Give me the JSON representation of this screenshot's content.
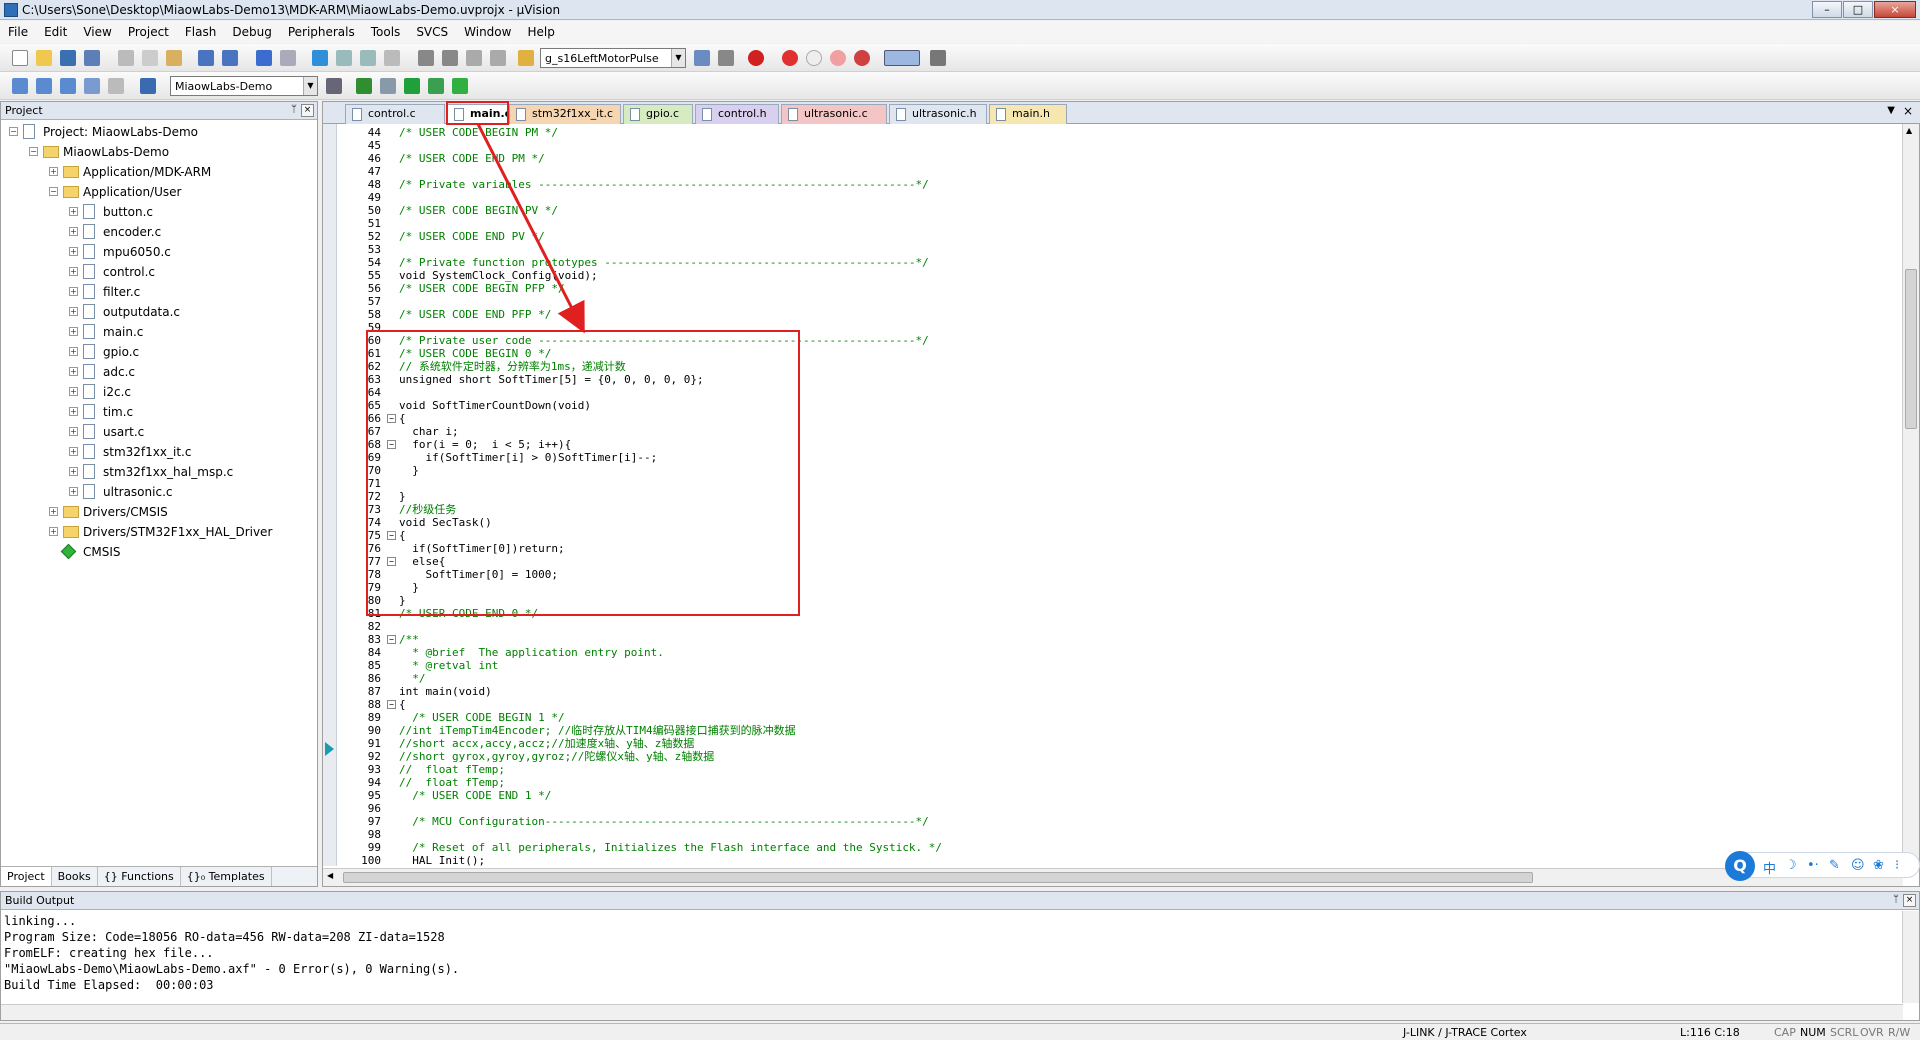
{
  "window": {
    "title": "C:\\Users\\Sone\\Desktop\\MiaowLabs-Demo13\\MDK-ARM\\MiaowLabs-Demo.uvprojx - µVision",
    "min": "–",
    "max": "□",
    "close": "×"
  },
  "menu": [
    "File",
    "Edit",
    "View",
    "Project",
    "Flash",
    "Debug",
    "Peripherals",
    "Tools",
    "SVCS",
    "Window",
    "Help"
  ],
  "toolbar": {
    "symbol_select": "g_s16LeftMotorPulse",
    "target_select": "MiaowLabs-Demo"
  },
  "project_panel": {
    "title": "Project",
    "pin": "ᛘ",
    "close": "×",
    "root": "Project: MiaowLabs-Demo",
    "target": "MiaowLabs-Demo",
    "groups": [
      {
        "name": "Application/MDK-ARM",
        "expanded": false,
        "files": []
      },
      {
        "name": "Application/User",
        "expanded": true,
        "files": [
          "button.c",
          "encoder.c",
          "mpu6050.c",
          "control.c",
          "filter.c",
          "outputdata.c",
          "main.c",
          "gpio.c",
          "adc.c",
          "i2c.c",
          "tim.c",
          "usart.c",
          "stm32f1xx_it.c",
          "stm32f1xx_hal_msp.c",
          "ultrasonic.c"
        ]
      },
      {
        "name": "Drivers/CMSIS",
        "expanded": false,
        "files": []
      },
      {
        "name": "Drivers/STM32F1xx_HAL_Driver",
        "expanded": false,
        "files": []
      }
    ],
    "cmsis": "CMSIS",
    "tabs": [
      "Project",
      "Books",
      "{} Functions",
      "{}₀ Templates"
    ]
  },
  "editor": {
    "tabs": [
      {
        "label": "control.c",
        "color": "#dfe6ef",
        "active": false
      },
      {
        "label": "main.c",
        "color": "#ffffff",
        "active": true
      },
      {
        "label": "stm32f1xx_it.c",
        "color": "#f6d6b0",
        "active": false
      },
      {
        "label": "gpio.c",
        "color": "#d6ecc0",
        "active": false
      },
      {
        "label": "control.h",
        "color": "#d9cfee",
        "active": false
      },
      {
        "label": "ultrasonic.c",
        "color": "#f3c5c5",
        "active": false
      },
      {
        "label": "ultrasonic.h",
        "color": "#dfe6ef",
        "active": false
      },
      {
        "label": "main.h",
        "color": "#f6e7b0",
        "active": false
      }
    ],
    "lines": [
      {
        "n": "44",
        "t": "/* USER CODE BEGIN PM */",
        "c": "cm"
      },
      {
        "n": "45",
        "t": "",
        "c": ""
      },
      {
        "n": "46",
        "t": "/* USER CODE END PM */",
        "c": "cm"
      },
      {
        "n": "47",
        "t": "",
        "c": ""
      },
      {
        "n": "48",
        "t": "/* Private variables ---------------------------------------------------------*/",
        "c": "cm"
      },
      {
        "n": "49",
        "t": "",
        "c": ""
      },
      {
        "n": "50",
        "t": "/* USER CODE BEGIN PV */",
        "c": "cm"
      },
      {
        "n": "51",
        "t": "",
        "c": ""
      },
      {
        "n": "52",
        "t": "/* USER CODE END PV */",
        "c": "cm"
      },
      {
        "n": "53",
        "t": "",
        "c": ""
      },
      {
        "n": "54",
        "t": "/* Private function prototypes -----------------------------------------------*/",
        "c": "cm"
      },
      {
        "n": "55",
        "t": "void SystemClock_Config(void);",
        "c": ""
      },
      {
        "n": "56",
        "t": "/* USER CODE BEGIN PFP */",
        "c": "cm"
      },
      {
        "n": "57",
        "t": "",
        "c": ""
      },
      {
        "n": "58",
        "t": "/* USER CODE END PFP */",
        "c": "cm"
      },
      {
        "n": "59",
        "t": "",
        "c": ""
      },
      {
        "n": "60",
        "t": "/* Private user code ---------------------------------------------------------*/",
        "c": "cm"
      },
      {
        "n": "61",
        "t": "/* USER CODE BEGIN 0 */",
        "c": "cm"
      },
      {
        "n": "62",
        "t": "// 系统软件定时器，分辨率为1ms，递减计数",
        "c": "cm"
      },
      {
        "n": "63",
        "t": "unsigned short SoftTimer[5] = {0, 0, 0, 0, 0};",
        "c": ""
      },
      {
        "n": "64",
        "t": "",
        "c": ""
      },
      {
        "n": "65",
        "t": "void SoftTimerCountDown(void)",
        "c": ""
      },
      {
        "n": "66",
        "t": "{",
        "c": "",
        "f": "−"
      },
      {
        "n": "67",
        "t": "  char i;",
        "c": ""
      },
      {
        "n": "68",
        "t": "  for(i = 0;  i < 5; i++){",
        "c": "",
        "f": "−"
      },
      {
        "n": "69",
        "t": "    if(SoftTimer[i] > 0)SoftTimer[i]--;",
        "c": ""
      },
      {
        "n": "70",
        "t": "  }",
        "c": ""
      },
      {
        "n": "71",
        "t": "",
        "c": ""
      },
      {
        "n": "72",
        "t": "}",
        "c": ""
      },
      {
        "n": "73",
        "t": "//秒级任务",
        "c": "cm"
      },
      {
        "n": "74",
        "t": "void SecTask()",
        "c": ""
      },
      {
        "n": "75",
        "t": "{",
        "c": "",
        "f": "−"
      },
      {
        "n": "76",
        "t": "  if(SoftTimer[0])return;",
        "c": ""
      },
      {
        "n": "77",
        "t": "  else{",
        "c": "",
        "f": "−"
      },
      {
        "n": "78",
        "t": "    SoftTimer[0] = 1000;",
        "c": ""
      },
      {
        "n": "79",
        "t": "  }",
        "c": ""
      },
      {
        "n": "80",
        "t": "}",
        "c": ""
      },
      {
        "n": "81",
        "t": "/* USER CODE END 0 */",
        "c": "cm"
      },
      {
        "n": "82",
        "t": "",
        "c": ""
      },
      {
        "n": "83",
        "t": "/**",
        "c": "cm",
        "f": "−"
      },
      {
        "n": "84",
        "t": "  * @brief  The application entry point.",
        "c": "cm"
      },
      {
        "n": "85",
        "t": "  * @retval int",
        "c": "cm"
      },
      {
        "n": "86",
        "t": "  */",
        "c": "cm"
      },
      {
        "n": "87",
        "t": "int main(void)",
        "c": ""
      },
      {
        "n": "88",
        "t": "{",
        "c": "",
        "f": "−"
      },
      {
        "n": "89",
        "t": "  /* USER CODE BEGIN 1 */",
        "c": "cm"
      },
      {
        "n": "90",
        "t": "//int iTempTim4Encoder; //临时存放从TIM4编码器接口捕获到的脉冲数据",
        "c": "cm"
      },
      {
        "n": "91",
        "t": "//short accx,accy,accz;//加速度x轴、y轴、z轴数据",
        "c": "cm"
      },
      {
        "n": "92",
        "t": "//short gyrox,gyroy,gyroz;//陀螺仪x轴、y轴、z轴数据",
        "c": "cm"
      },
      {
        "n": "93",
        "t": "//  float fTemp;",
        "c": "cm"
      },
      {
        "n": "94",
        "t": "//  float fTemp;",
        "c": "cm"
      },
      {
        "n": "95",
        "t": "  /* USER CODE END 1 */",
        "c": "cm"
      },
      {
        "n": "96",
        "t": "",
        "c": ""
      },
      {
        "n": "97",
        "t": "  /* MCU Configuration--------------------------------------------------------*/",
        "c": "cm"
      },
      {
        "n": "98",
        "t": "",
        "c": ""
      },
      {
        "n": "99",
        "t": "  /* Reset of all peripherals, Initializes the Flash interface and the Systick. */",
        "c": "cm"
      },
      {
        "n": "100",
        "t": "  HAL_Init();",
        "c": ""
      }
    ]
  },
  "build_output": {
    "title": "Build Output",
    "lines": [
      "linking...",
      "Program Size: Code=18056 RO-data=456 RW-data=208 ZI-data=1528",
      "FromELF: creating hex file...",
      "\"MiaowLabs-Demo\\MiaowLabs-Demo.axf\" - 0 Error(s), 0 Warning(s).",
      "Build Time Elapsed:  00:00:03"
    ]
  },
  "status": {
    "debugger": "J-LINK / J-TRACE Cortex",
    "position": "L:116 C:18",
    "cap": "CAP",
    "num": "NUM",
    "scrl": "SCRL",
    "ovr": "OVR",
    "rw": "R/W"
  },
  "ime": {
    "logo": "Q",
    "glyphs": [
      "中",
      "☽",
      "•·",
      "✎",
      "☺",
      "❀",
      "⁝"
    ]
  }
}
